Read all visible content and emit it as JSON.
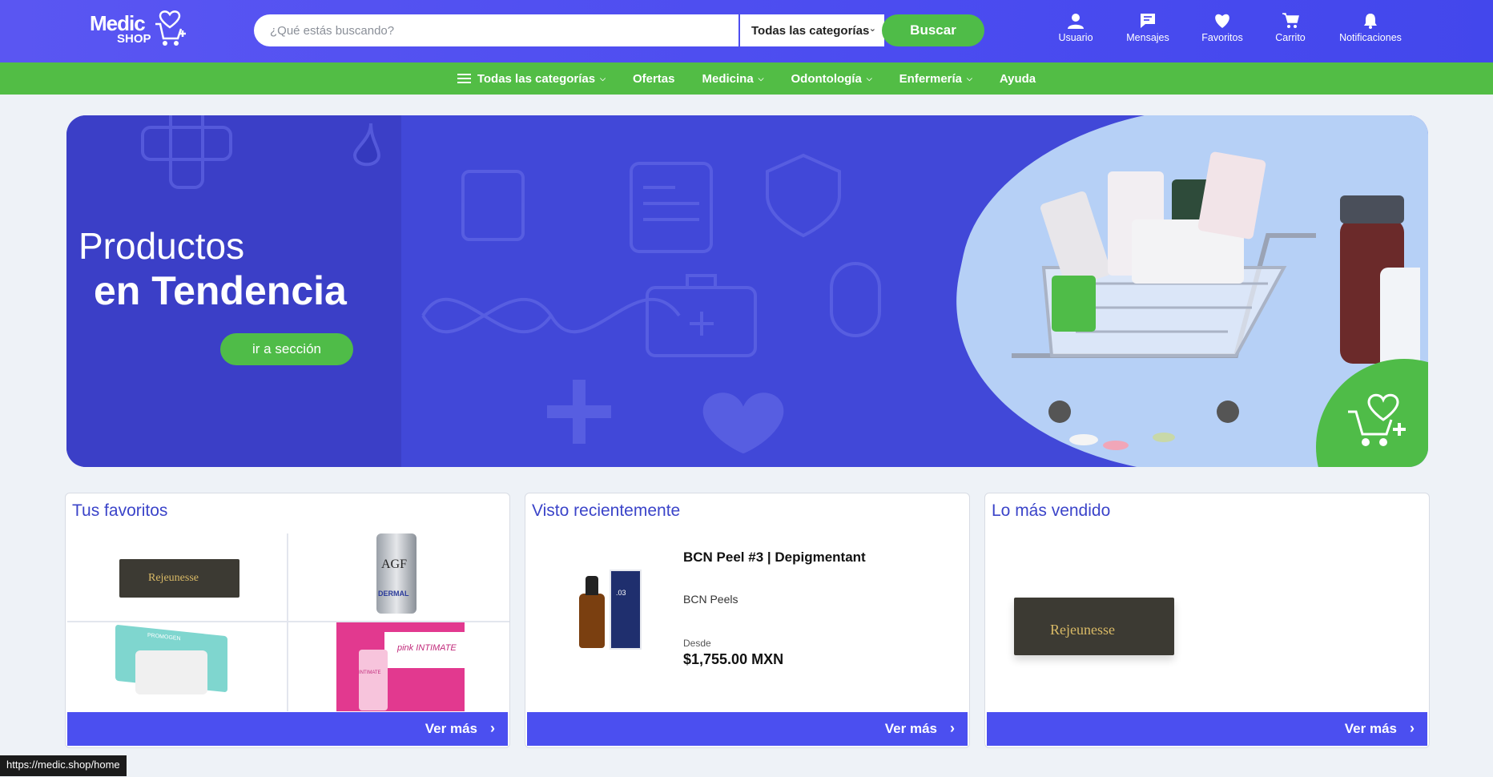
{
  "header": {
    "logo_line1": "Medic",
    "logo_line2": "SHOP",
    "search_placeholder": "¿Qué estás buscando?",
    "category_select": "Todas las categorías",
    "search_button": "Buscar",
    "icons": [
      {
        "label": "Usuario",
        "icon": "user-icon"
      },
      {
        "label": "Mensajes",
        "icon": "message-icon"
      },
      {
        "label": "Favoritos",
        "icon": "heart-icon"
      },
      {
        "label": "Carrito",
        "icon": "cart-icon"
      },
      {
        "label": "Notificaciones",
        "icon": "bell-icon"
      }
    ]
  },
  "nav": {
    "all_categories": "Todas las categorías",
    "offers": "Ofertas",
    "medicine": "Medicina",
    "dentistry": "Odontología",
    "nursing": "Enfermería",
    "help": "Ayuda"
  },
  "banner": {
    "title_line1": "Productos",
    "title_line2": "en Tendencia",
    "button": "ir a sección"
  },
  "favorites": {
    "title": "Tus favoritos",
    "products": [
      {
        "label": "Rejeunesse"
      },
      {
        "label": "AGF",
        "sub": "DERMAL"
      },
      {
        "label": "PROMOGEN"
      },
      {
        "label": "pink INTIMATE",
        "sub": "INTIMATE"
      }
    ],
    "more": "Ver más"
  },
  "recent": {
    "title": "Visto recientemente",
    "product_name": "BCN Peel #3 | Depigmentant",
    "brand": "BCN Peels",
    "from_label": "Desde",
    "price": "$1,755.00 MXN",
    "box_text": ".03",
    "more": "Ver más"
  },
  "bestseller": {
    "title": "Lo más vendido",
    "product_label": "Rejeunesse",
    "more": "Ver más"
  },
  "status_url": "https://medic.shop/home",
  "colors": {
    "header_blue": "#4b4cf0",
    "nav_green": "#52bd45",
    "accent_green": "#4fbc48",
    "title_blue": "#3b44c9"
  }
}
